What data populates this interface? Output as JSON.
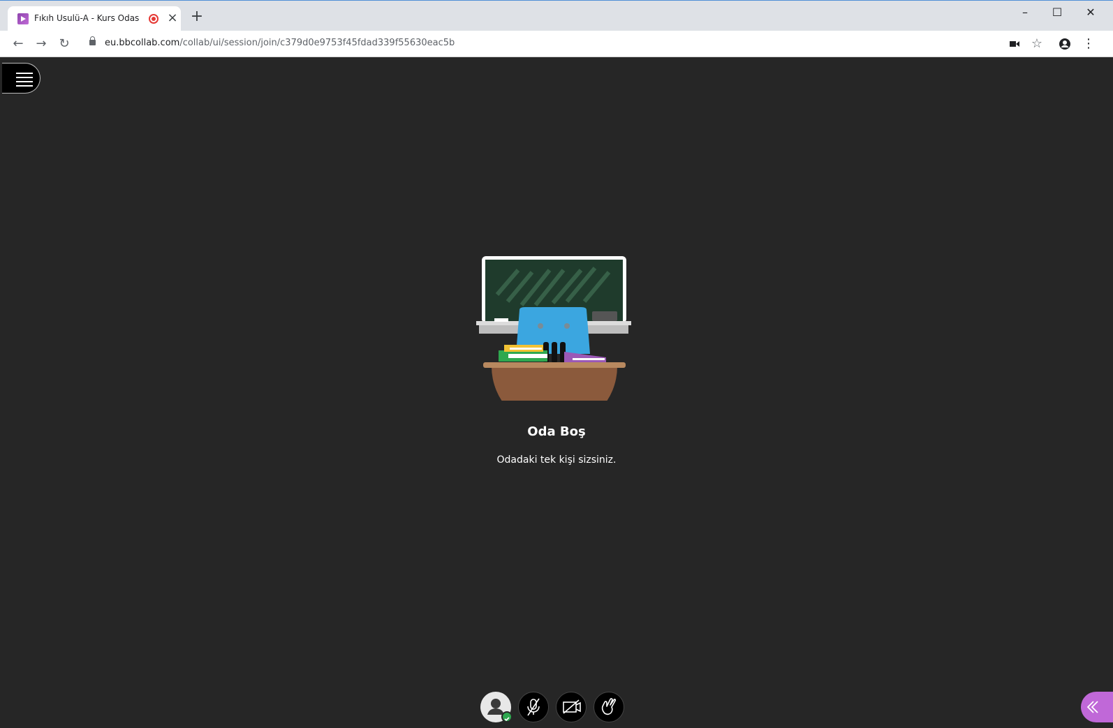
{
  "browser": {
    "tab_title": "Fıkıh Usulü-A - Kurs Odası - I",
    "url_host": "eu.bbcollab.com",
    "url_path": "/collab/ui/session/join/c379d0e9753f45fdad339f55630eac5b"
  },
  "room": {
    "title": "Oda Boş",
    "message": "Odadaki tek kişi sizsiniz."
  },
  "colors": {
    "page_bg": "#262626",
    "accent_purple": "#c068d8",
    "status_green": "#2ea84f",
    "recording_red": "#e53935"
  },
  "icons": [
    "menu-icon",
    "avatar-icon",
    "microphone-muted-icon",
    "camera-off-icon",
    "raise-hand-icon",
    "chevron-left-double-icon"
  ]
}
